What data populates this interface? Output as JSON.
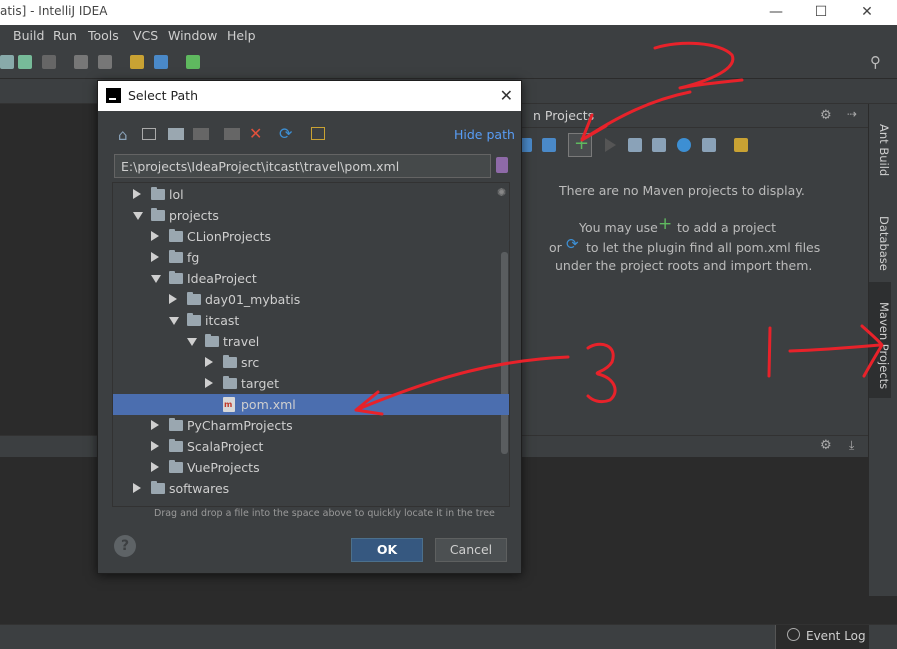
{
  "window": {
    "title": "atis] - IntelliJ IDEA"
  },
  "menu": [
    "Build",
    "Run",
    "Tools",
    "VCS",
    "Window",
    "Help"
  ],
  "maven": {
    "title": "n Projects",
    "empty_line1": "There are no Maven projects to display.",
    "use_prefix": "You may use",
    "use_suffix": "to add a project",
    "or_prefix": "or",
    "or_suffix": "to let the plugin find all pom.xml files",
    "line3": "under the project roots and import them."
  },
  "right_tabs": [
    "Ant Build",
    "Database",
    "Maven Projects"
  ],
  "status": {
    "event_log": "Event Log"
  },
  "dialog": {
    "title": "Select Path",
    "hide_path": "Hide path",
    "path_value": "E:\\projects\\IdeaProject\\itcast\\travel\\pom.xml",
    "tree": [
      {
        "label": "lol",
        "depth": 1,
        "state": "collapsed",
        "kind": "folder"
      },
      {
        "label": "projects",
        "depth": 1,
        "state": "expanded",
        "kind": "folder"
      },
      {
        "label": "CLionProjects",
        "depth": 2,
        "state": "collapsed",
        "kind": "folder"
      },
      {
        "label": "fg",
        "depth": 2,
        "state": "collapsed",
        "kind": "folder"
      },
      {
        "label": "IdeaProject",
        "depth": 2,
        "state": "expanded",
        "kind": "folder"
      },
      {
        "label": "day01_mybatis",
        "depth": 3,
        "state": "collapsed",
        "kind": "folder"
      },
      {
        "label": "itcast",
        "depth": 3,
        "state": "expanded",
        "kind": "folder"
      },
      {
        "label": "travel",
        "depth": 4,
        "state": "expanded",
        "kind": "folder"
      },
      {
        "label": "src",
        "depth": 5,
        "state": "collapsed",
        "kind": "folder"
      },
      {
        "label": "target",
        "depth": 5,
        "state": "collapsed",
        "kind": "folder"
      },
      {
        "label": "pom.xml",
        "depth": 5,
        "state": "leaf",
        "kind": "file",
        "selected": true
      },
      {
        "label": "PyCharmProjects",
        "depth": 2,
        "state": "collapsed",
        "kind": "folder"
      },
      {
        "label": "ScalaProject",
        "depth": 2,
        "state": "collapsed",
        "kind": "folder"
      },
      {
        "label": "VueProjects",
        "depth": 2,
        "state": "collapsed",
        "kind": "folder"
      },
      {
        "label": "softwares",
        "depth": 1,
        "state": "collapsed",
        "kind": "folder"
      }
    ],
    "hint": "Drag and drop a file into the space above to quickly locate it in the tree",
    "ok_label": "OK",
    "cancel_label": "Cancel",
    "help_label": "?"
  },
  "colors": {
    "accent_link": "#589df6",
    "selection": "#4b6eaf",
    "annotation_red": "#e8222a",
    "add_green": "#5fb95f"
  }
}
